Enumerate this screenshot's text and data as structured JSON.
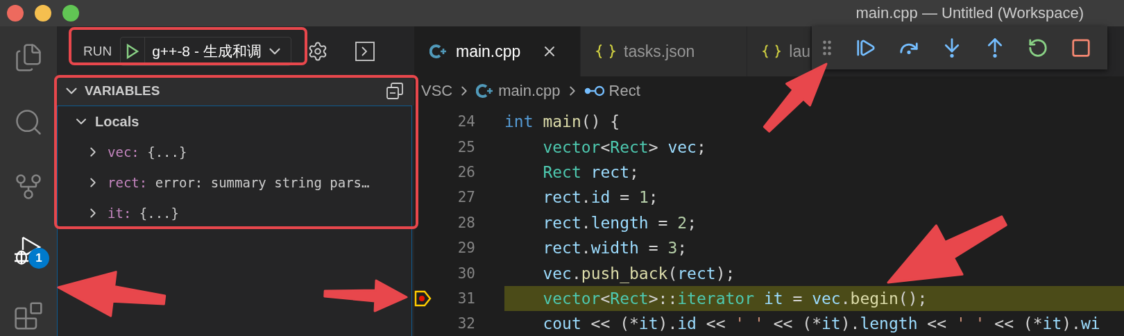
{
  "window": {
    "title": "main.cpp — Untitled (Workspace)"
  },
  "activity_bar": {
    "items": [
      {
        "kind": "explorer",
        "selected": false
      },
      {
        "kind": "search",
        "selected": false
      },
      {
        "kind": "scm",
        "selected": false
      },
      {
        "kind": "debug",
        "selected": true,
        "badge": "1"
      },
      {
        "kind": "extensions",
        "selected": false
      }
    ]
  },
  "run_bar": {
    "label": "RUN",
    "configuration": "g++-8 - 生成和调"
  },
  "variables": {
    "title": "VARIABLES",
    "expanded": true,
    "scopes": [
      {
        "name": "Locals",
        "expanded": true,
        "children": [
          {
            "name": "vec:",
            "value": "{...}",
            "expanded": false
          },
          {
            "name": "rect:",
            "value": "error: summary string pars…",
            "expanded": false
          },
          {
            "name": "it:",
            "value": "{...}",
            "expanded": false
          }
        ]
      }
    ]
  },
  "tabs": [
    {
      "label": "main.cpp",
      "kind": "cpp",
      "selected": true
    },
    {
      "label": "tasks.json",
      "kind": "json",
      "selected": false
    },
    {
      "label": "lau",
      "kind": "json",
      "selected": false
    }
  ],
  "breadcrumb": [
    {
      "label": "VSC",
      "kind": "folder"
    },
    {
      "label": "main.cpp",
      "kind": "cpp"
    },
    {
      "label": "Rect",
      "kind": "struct"
    }
  ],
  "debug_toolbar": {
    "buttons": [
      {
        "kind": "continue"
      },
      {
        "kind": "step_over"
      },
      {
        "kind": "step_into"
      },
      {
        "kind": "step_out"
      },
      {
        "kind": "restart"
      },
      {
        "kind": "stop"
      }
    ]
  },
  "editor": {
    "lines": [
      {
        "number": "24",
        "current": false,
        "indented": false,
        "tokens": [
          {
            "kind": "keyword",
            "text": "int"
          },
          {
            "kind": "function",
            "text": " main"
          },
          {
            "kind": "plain",
            "text": "() {"
          }
        ]
      },
      {
        "number": "25",
        "current": false,
        "indented": true,
        "tokens": [
          {
            "kind": "type",
            "text": "vector"
          },
          {
            "kind": "plain",
            "text": "<"
          },
          {
            "kind": "type",
            "text": "Rect"
          },
          {
            "kind": "plain",
            "text": "> "
          },
          {
            "kind": "variable",
            "text": "vec"
          },
          {
            "kind": "plain",
            "text": ";"
          }
        ]
      },
      {
        "number": "26",
        "current": false,
        "indented": true,
        "tokens": [
          {
            "kind": "type",
            "text": "Rect"
          },
          {
            "kind": "variable",
            "text": " rect"
          },
          {
            "kind": "plain",
            "text": ";"
          }
        ]
      },
      {
        "number": "27",
        "current": false,
        "indented": true,
        "tokens": [
          {
            "kind": "variable",
            "text": "rect"
          },
          {
            "kind": "plain",
            "text": "."
          },
          {
            "kind": "variable",
            "text": "id"
          },
          {
            "kind": "plain",
            "text": " = "
          },
          {
            "kind": "number",
            "text": "1"
          },
          {
            "kind": "plain",
            "text": ";"
          }
        ]
      },
      {
        "number": "28",
        "current": false,
        "indented": true,
        "tokens": [
          {
            "kind": "variable",
            "text": "rect"
          },
          {
            "kind": "plain",
            "text": "."
          },
          {
            "kind": "variable",
            "text": "length"
          },
          {
            "kind": "plain",
            "text": " = "
          },
          {
            "kind": "number",
            "text": "2"
          },
          {
            "kind": "plain",
            "text": ";"
          }
        ]
      },
      {
        "number": "29",
        "current": false,
        "indented": true,
        "tokens": [
          {
            "kind": "variable",
            "text": "rect"
          },
          {
            "kind": "plain",
            "text": "."
          },
          {
            "kind": "variable",
            "text": "width"
          },
          {
            "kind": "plain",
            "text": " = "
          },
          {
            "kind": "number",
            "text": "3"
          },
          {
            "kind": "plain",
            "text": ";"
          }
        ]
      },
      {
        "number": "30",
        "current": false,
        "indented": true,
        "tokens": [
          {
            "kind": "variable",
            "text": "vec"
          },
          {
            "kind": "plain",
            "text": "."
          },
          {
            "kind": "function",
            "text": "push_back"
          },
          {
            "kind": "plain",
            "text": "("
          },
          {
            "kind": "variable",
            "text": "rect"
          },
          {
            "kind": "plain",
            "text": ");"
          }
        ]
      },
      {
        "number": "31",
        "current": true,
        "indented": true,
        "tokens": [
          {
            "kind": "type",
            "text": "vector"
          },
          {
            "kind": "plain",
            "text": "<"
          },
          {
            "kind": "type",
            "text": "Rect"
          },
          {
            "kind": "plain",
            "text": ">::"
          },
          {
            "kind": "type",
            "text": "iterator"
          },
          {
            "kind": "variable",
            "text": " it"
          },
          {
            "kind": "plain",
            "text": " = "
          },
          {
            "kind": "variable",
            "text": "vec"
          },
          {
            "kind": "plain",
            "text": "."
          },
          {
            "kind": "function",
            "text": "begin"
          },
          {
            "kind": "plain",
            "text": "();"
          }
        ]
      },
      {
        "number": "32",
        "current": false,
        "indented": true,
        "tokens": [
          {
            "kind": "variable",
            "text": "cout"
          },
          {
            "kind": "plain",
            "text": " << (*"
          },
          {
            "kind": "variable",
            "text": "it"
          },
          {
            "kind": "plain",
            "text": ")."
          },
          {
            "kind": "variable",
            "text": "id"
          },
          {
            "kind": "plain",
            "text": " << "
          },
          {
            "kind": "string",
            "text": "' '"
          },
          {
            "kind": "plain",
            "text": " << (*"
          },
          {
            "kind": "variable",
            "text": "it"
          },
          {
            "kind": "plain",
            "text": ")."
          },
          {
            "kind": "variable",
            "text": "length"
          },
          {
            "kind": "plain",
            "text": " << "
          },
          {
            "kind": "string",
            "text": "' '"
          },
          {
            "kind": "plain",
            "text": " << (*"
          },
          {
            "kind": "variable",
            "text": "it"
          },
          {
            "kind": "plain",
            "text": ")."
          },
          {
            "kind": "variable",
            "text": "wi"
          }
        ]
      }
    ]
  }
}
